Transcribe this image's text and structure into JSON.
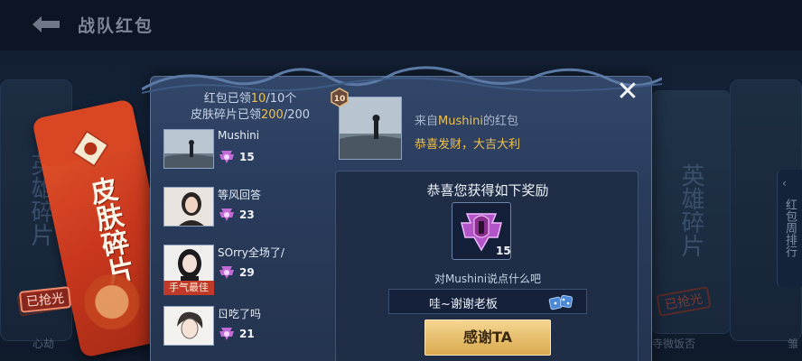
{
  "header": {
    "title": "战队红包"
  },
  "background": {
    "left_card_text": "英雄碎片",
    "right_card_text": "英雄碎片",
    "bottom_left_label": "心劫",
    "bottom_right_label": "寺微饭否",
    "bottom_far_right_label": "雏",
    "gone_left": "已抢光",
    "gone_right": "已抢光",
    "side_tab_label": "红包周排行"
  },
  "envelope": {
    "text": "皮肤碎片",
    "status": "已抢光"
  },
  "dialog": {
    "stats": {
      "envelope_prefix": "红包已领",
      "envelope_claimed": "10",
      "envelope_total": "/10个",
      "skin_prefix": "皮肤碎片已领",
      "skin_claimed": "200",
      "skin_total": "/200"
    },
    "claims": [
      {
        "name": "Mushini",
        "count": "15",
        "tag": ""
      },
      {
        "name": "等风回答",
        "count": "23",
        "tag": ""
      },
      {
        "name": "SOrry全场了/",
        "count": "29",
        "tag": "手气最佳"
      },
      {
        "name": "ㄖ吃了吗",
        "count": "21",
        "tag": ""
      }
    ],
    "rank_badge": "10",
    "sender": {
      "from_prefix": "来自",
      "from_name": "Mushini",
      "from_suffix": "的红包",
      "blessing": "恭喜发财，大吉大利"
    },
    "reward": {
      "title": "恭喜您获得如下奖励",
      "quantity": "15",
      "say_label": "对Mushini说点什么吧",
      "message": "哇~谢谢老板",
      "thanks_button": "感谢TA"
    }
  },
  "colors": {
    "accent_gold": "#f0c04a",
    "button_gold": "#e3b865",
    "panel_blue": "#2a3c5c"
  }
}
